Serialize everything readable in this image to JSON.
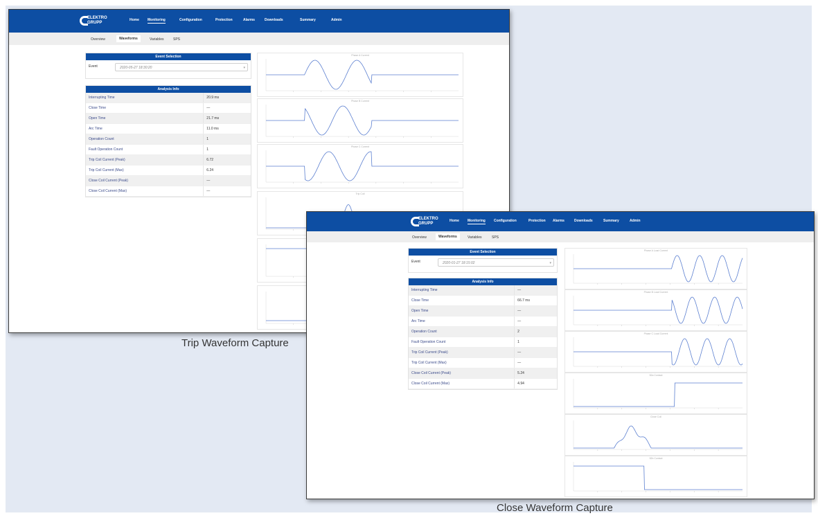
{
  "nav": {
    "logo_text": "ELEKTRO GRUPP",
    "items": [
      "Home",
      "Monitoring",
      "Configuration",
      "Protection",
      "Alarms",
      "Downloads",
      "Summary",
      "Admin"
    ],
    "active": "Monitoring"
  },
  "subnav": {
    "tabs": [
      "Overview",
      "Waveforms",
      "Variables",
      "SPS"
    ],
    "active": "Waveforms"
  },
  "trip": {
    "event_selection": {
      "header": "Event Selection",
      "label": "Event",
      "value": "2020-05-27 18:30:20"
    },
    "analysis": {
      "header": "Analysis Info",
      "rows": [
        {
          "label": "Interrupting Time",
          "value": "20.9 ms"
        },
        {
          "label": "Close Time",
          "value": "—"
        },
        {
          "label": "Open Time",
          "value": "21.7 ms"
        },
        {
          "label": "Arc Time",
          "value": "11.0 ms"
        },
        {
          "label": "Operation Count",
          "value": "1"
        },
        {
          "label": "Fault Operation Count",
          "value": "1"
        },
        {
          "label": "Trip Coil Current (Peak)",
          "value": "6.72"
        },
        {
          "label": "Trip Coil Current (Max)",
          "value": "6.24"
        },
        {
          "label": "Close Coil Current (Peak)",
          "value": "—"
        },
        {
          "label": "Close Coil Current (Max)",
          "value": "—"
        }
      ]
    },
    "charts": [
      "Phase A Current",
      "Phase B Current",
      "Phase C Current",
      "Trip Coil",
      "",
      ""
    ],
    "caption": "Trip Waveform Capture"
  },
  "close": {
    "event_selection": {
      "header": "Event Selection",
      "label": "Event",
      "value": "2020-01-27 18:15:02"
    },
    "analysis": {
      "header": "Analysis Info",
      "rows": [
        {
          "label": "Interrupting Time",
          "value": "—"
        },
        {
          "label": "Close Time",
          "value": "66.7 ms"
        },
        {
          "label": "Open Time",
          "value": "—"
        },
        {
          "label": "Arc Time",
          "value": "—"
        },
        {
          "label": "Operation Count",
          "value": "2"
        },
        {
          "label": "Fault Operation Count",
          "value": "1"
        },
        {
          "label": "Trip Coil Current (Peak)",
          "value": "—"
        },
        {
          "label": "Trip Coil Current (Max)",
          "value": "—"
        },
        {
          "label": "Close Coil Current (Peak)",
          "value": "5.24"
        },
        {
          "label": "Close Coil Current (Max)",
          "value": "4.94"
        }
      ]
    },
    "charts": [
      "Phase A Load Current",
      "Phase B Load Current",
      "Phase C Load Current",
      "52a Contact",
      "Close Coil",
      "52b Contact"
    ],
    "caption": "Close Waveform Capture"
  },
  "colors": {
    "nav_blue": "#0d4ea3",
    "waveform": "#5b7fd0",
    "background": "#e3e9f3"
  }
}
